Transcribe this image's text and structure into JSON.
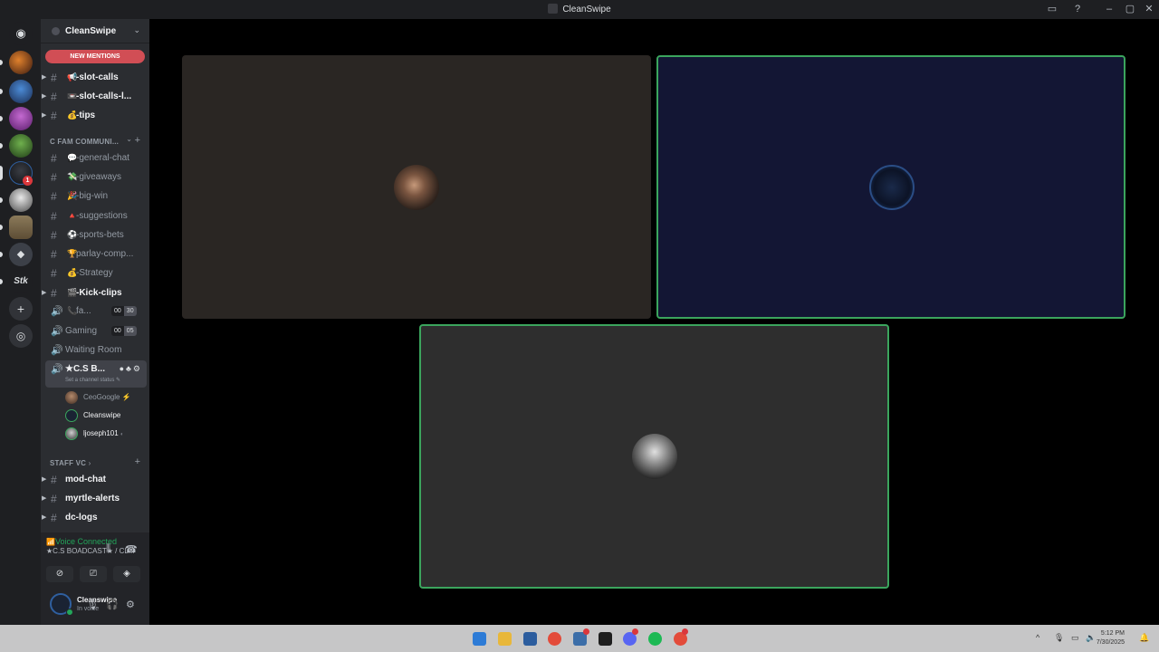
{
  "window": {
    "title": "CleanSwipe"
  },
  "server": {
    "name": "CleanSwipe",
    "new_mentions": "NEW MENTIONS"
  },
  "channels_top": [
    {
      "emoji": "📢",
      "label": "-slot-calls"
    },
    {
      "emoji": "📼",
      "label": "-slot-calls-l..."
    },
    {
      "emoji": "💰",
      "label": "-tips"
    }
  ],
  "category_community": "C FAM COMMUNI...",
  "channels_community": [
    {
      "emoji": "💬",
      "label": "-general-chat"
    },
    {
      "emoji": "💸",
      "label": "-giveaways"
    },
    {
      "emoji": "🎉",
      "label": "-big-win"
    },
    {
      "emoji": "🔺",
      "label": "-suggestions"
    },
    {
      "emoji": "⚽",
      "label": "-sports-bets"
    },
    {
      "emoji": "🏆",
      "label": "parlay-comp..."
    },
    {
      "emoji": "💰",
      "label": "-Strategy"
    },
    {
      "emoji": "🎬",
      "label": "-Kick-clips"
    }
  ],
  "voice_channels": [
    {
      "emoji": "📞",
      "label": "fa...",
      "count_a": "00",
      "count_b": "30"
    },
    {
      "emoji": "",
      "label": "Gaming",
      "count_a": "00",
      "count_b": "05"
    },
    {
      "emoji": "",
      "label": "Waiting Room"
    }
  ],
  "active_vc": {
    "name": "★C.S B...",
    "status": "Set a channel status"
  },
  "vc_users": [
    {
      "name": "CeoGoogle"
    },
    {
      "name": "Cleanswipe"
    },
    {
      "name": "ljoseph101"
    }
  ],
  "category_staff": "STAFF VC",
  "channels_staff": [
    {
      "label": "mod-chat"
    },
    {
      "label": "myrtle-alerts"
    },
    {
      "label": "dc-logs"
    }
  ],
  "voice_status": {
    "title": "Voice Connected",
    "channel": "★C.S BOADCAST★ / CL..."
  },
  "me": {
    "name": "Cleanswipe",
    "status": "In voice"
  },
  "tray": {
    "time": "5:12 PM",
    "date": "7/30/2025"
  },
  "colors": {
    "speaking": "#3ba55d",
    "online": "#23a55a",
    "mention": "#da373c",
    "blurple": "#5865f2"
  }
}
